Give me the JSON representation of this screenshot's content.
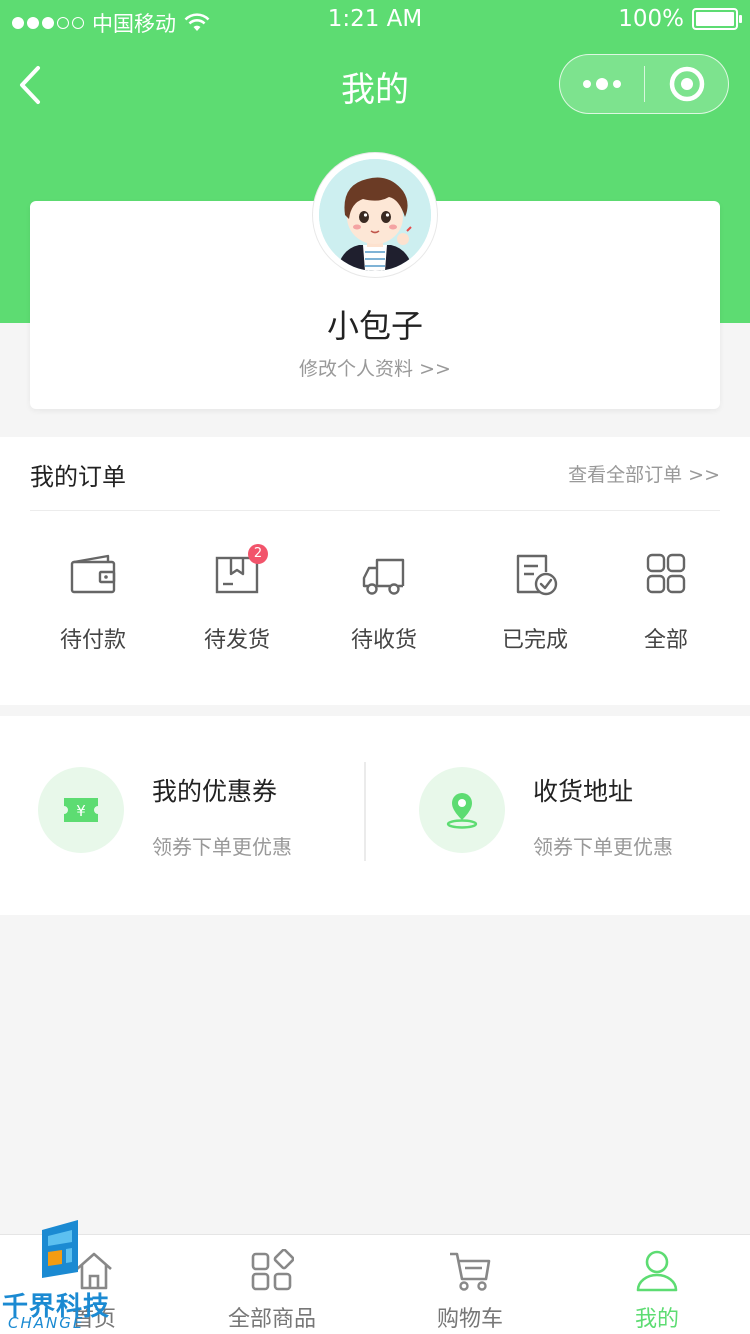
{
  "status_bar": {
    "carrier": "中国移动",
    "time": "1:21 AM",
    "battery": "100%"
  },
  "nav": {
    "title": "我的"
  },
  "profile": {
    "name": "小包子",
    "edit_link": "修改个人资料 >>"
  },
  "orders": {
    "title": "我的订单",
    "view_all": "查看全部订单 >>",
    "items": [
      {
        "label": "待付款",
        "icon": "wallet-icon"
      },
      {
        "label": "待发货",
        "icon": "package-icon",
        "badge": "2"
      },
      {
        "label": "待收货",
        "icon": "truck-icon"
      },
      {
        "label": "已完成",
        "icon": "check-document-icon"
      },
      {
        "label": "全部",
        "icon": "grid-icon"
      }
    ]
  },
  "services": [
    {
      "title": "我的优惠券",
      "subtitle": "领券下单更优惠",
      "icon": "coupon-icon"
    },
    {
      "title": "收货地址",
      "subtitle": "领券下单更优惠",
      "icon": "location-icon"
    }
  ],
  "tabbar": [
    {
      "label": "首页",
      "icon": "home-icon"
    },
    {
      "label": "全部商品",
      "icon": "categories-icon"
    },
    {
      "label": "购物车",
      "icon": "cart-icon"
    },
    {
      "label": "我的",
      "icon": "user-icon",
      "active": true
    }
  ],
  "watermark": {
    "text": "千界科技",
    "sub": "CHANGE"
  },
  "colors": {
    "primary": "#5ddc72",
    "badge": "#f2546b",
    "background": "#f5f5f5"
  }
}
